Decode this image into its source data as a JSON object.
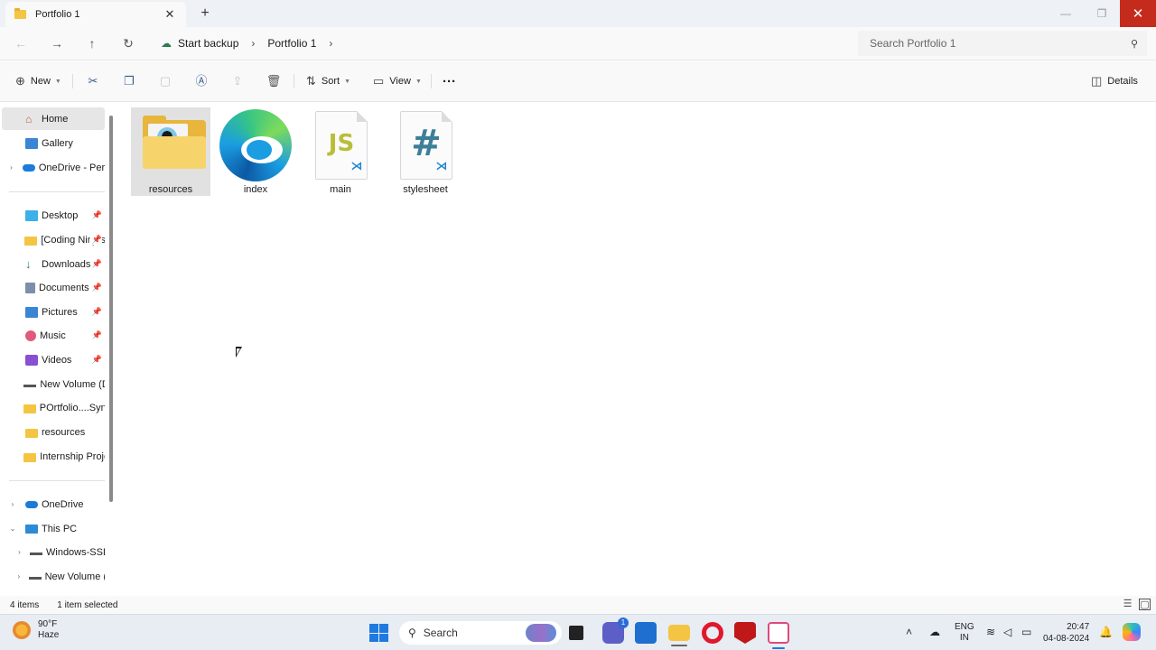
{
  "window": {
    "tab_title": "Portfolio 1",
    "new_tab": "+",
    "close_tab": "✕"
  },
  "address": {
    "backup_label": "Start backup",
    "current_folder": "Portfolio 1",
    "search_placeholder": "Search Portfolio 1"
  },
  "toolbar": {
    "new_label": "New",
    "sort_label": "Sort",
    "view_label": "View",
    "more_label": "···",
    "details_label": "Details"
  },
  "nav": {
    "home": "Home",
    "gallery": "Gallery",
    "onedrive_personal": "OneDrive - Personal",
    "desktop": "Desktop",
    "coding_ninjas": "[Coding Ninjas]",
    "downloads": "Downloads",
    "documents": "Documents",
    "pictures": "Pictures",
    "music": "Music",
    "videos": "Videos",
    "new_volume_d": "New Volume (D:)",
    "portfolio_syntax": "POrtfolio....Syntax",
    "resources": "resources",
    "internship": "Internship Project",
    "onedrive": "OneDrive",
    "this_pc": "This PC",
    "windows_ssd": "Windows-SSD",
    "new_volume": "New Volume (D:)"
  },
  "files": [
    {
      "name": "resources"
    },
    {
      "name": "index"
    },
    {
      "name": "main",
      "glyph": "JS"
    },
    {
      "name": "stylesheet",
      "glyph": "#"
    }
  ],
  "status": {
    "count": "4 items",
    "selected": "1 item selected"
  },
  "taskbar": {
    "temp": "90°F",
    "condition": "Haze",
    "search": "Search",
    "chat_badge": "1",
    "lang1": "ENG",
    "lang2": "IN",
    "time": "20:47",
    "date": "04-08-2024"
  }
}
